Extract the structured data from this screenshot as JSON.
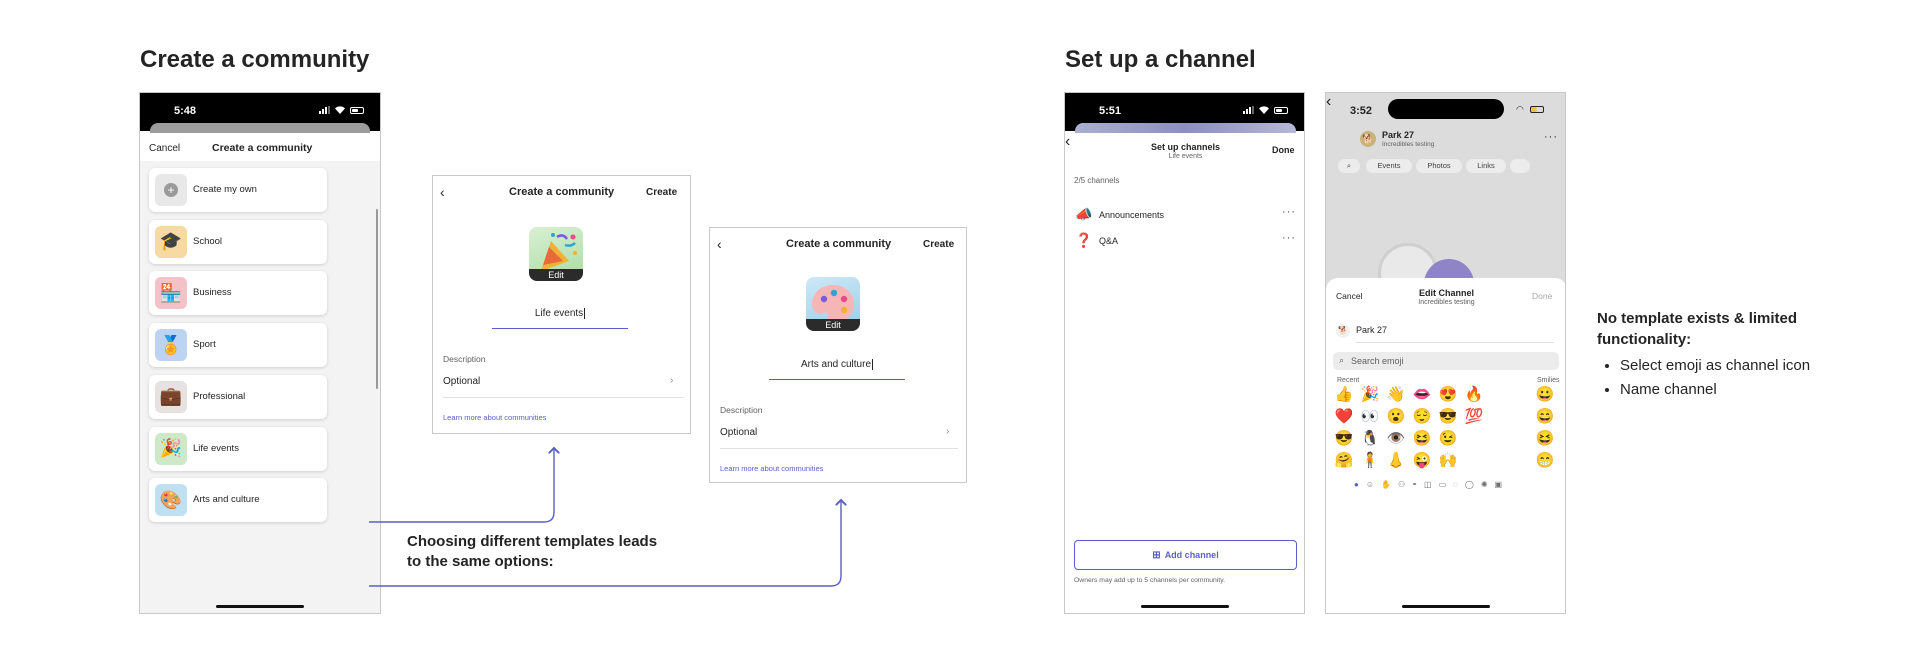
{
  "sections": {
    "community_title": "Create a community",
    "channel_title": "Set up a channel"
  },
  "phone1": {
    "time": "5:48",
    "cancel": "Cancel",
    "title": "Create a community",
    "templates": [
      {
        "label": "Create my own",
        "icon": "plus-icon",
        "bg": "#e8e8e8",
        "glyph": "+"
      },
      {
        "label": "School",
        "icon": "graduation-cap-icon",
        "bg": "#f7d9a3",
        "glyph": "🎓"
      },
      {
        "label": "Business",
        "icon": "store-icon",
        "bg": "#f3c1c8",
        "glyph": "🏪"
      },
      {
        "label": "Sport",
        "icon": "medal-icon",
        "bg": "#bcd3f2",
        "glyph": "🏅"
      },
      {
        "label": "Professional",
        "icon": "briefcase-icon",
        "bg": "#e6e2e2",
        "glyph": "💼"
      },
      {
        "label": "Life events",
        "icon": "party-popper-icon",
        "bg": "#cde9c8",
        "glyph": "🎉"
      },
      {
        "label": "Arts and culture",
        "icon": "palette-icon",
        "bg": "#bfe0f2",
        "glyph": "🎨"
      }
    ]
  },
  "panel_life": {
    "title": "Create a community",
    "action": "Create",
    "edit": "Edit",
    "name": "Life events",
    "desc_label": "Description",
    "desc_value": "Optional",
    "learn": "Learn more about communities"
  },
  "panel_arts": {
    "title": "Create a community",
    "action": "Create",
    "edit": "Edit",
    "name": "Arts and culture",
    "desc_label": "Description",
    "desc_value": "Optional",
    "learn": "Learn more about communities"
  },
  "caption": {
    "line1": "Choosing different templates leads",
    "line2": "to the same options:"
  },
  "phone_channels": {
    "time": "5:51",
    "title": "Set up channels",
    "subtitle": "Life events",
    "done": "Done",
    "count": "2/5 channels",
    "channels": [
      {
        "name": "Announcements",
        "icon": "megaphone-icon",
        "glyph": "📣"
      },
      {
        "name": "Q&A",
        "icon": "question-icon",
        "glyph": "❓"
      }
    ],
    "add": "Add channel",
    "footnote": "Owners may add up to 5 channels per community."
  },
  "phone_edit": {
    "time": "3:52",
    "group_name": "Park 27",
    "group_sub": "Incredibles testing",
    "pills": [
      "Events",
      "Photos",
      "Links"
    ],
    "cancel": "Cancel",
    "title": "Edit Channel",
    "subtitle": "Incredibles testing",
    "done": "Done",
    "channel_name": "Park 27",
    "search_placeholder": "Search emoji",
    "recent_label": "Recent",
    "smilies_label": "Smilies",
    "recent_emojis": [
      "👍",
      "🎉",
      "👋",
      "👄",
      "😍",
      "🔥",
      "❤️",
      "👀",
      "😮",
      "😌",
      "😎",
      "💯",
      "😎",
      "🐧",
      "👁️",
      "😆",
      "😉",
      "",
      "🤗",
      "🧍",
      "👃",
      "😜",
      "🙌",
      ""
    ],
    "smilies_emojis": [
      "😀",
      "😄",
      "😆",
      "😁"
    ]
  },
  "notes": {
    "title_line1": "No template exists & limited",
    "title_line2": "functionality:",
    "items": [
      "Select emoji as channel icon",
      "Name channel"
    ]
  }
}
